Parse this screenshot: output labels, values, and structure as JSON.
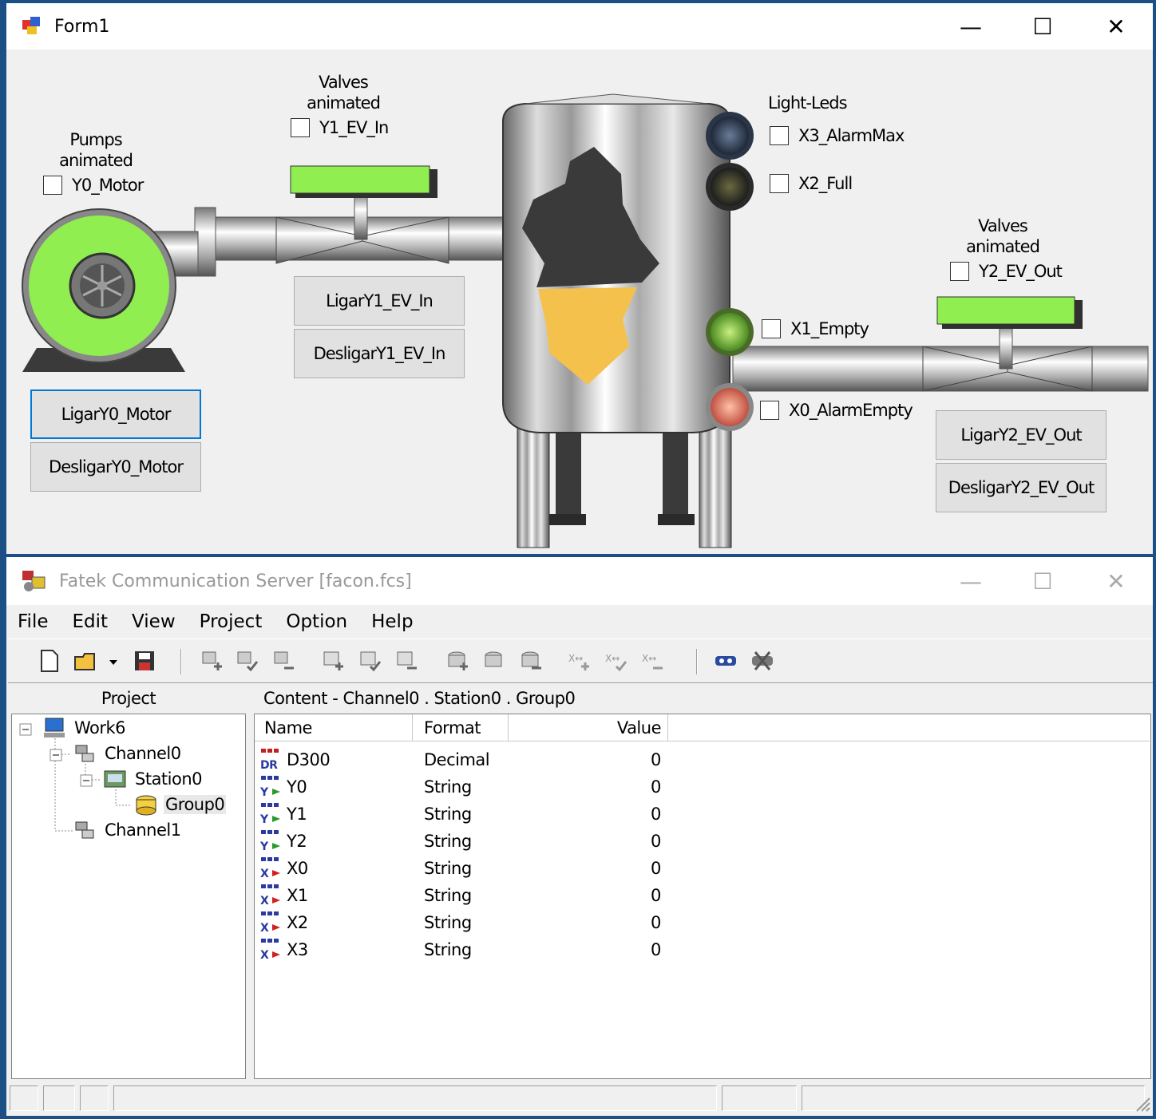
{
  "form1": {
    "title": "Form1",
    "pump": {
      "label": "Pumps\nanimated",
      "checkbox": "Y0_Motor",
      "on_button": "LigarY0_Motor",
      "off_button": "DesligarY0_Motor",
      "color": "#90ee50"
    },
    "valve_in": {
      "label": "Valves\nanimated",
      "checkbox": "Y1_EV_In",
      "on_button": "LigarY1_EV_In",
      "off_button": "DesligarY1_EV_In"
    },
    "leds": {
      "label": "Light-Leds",
      "x3": "X3_AlarmMax",
      "x2": "X2_Full",
      "x1": "X1_Empty",
      "x0": "X0_AlarmEmpty"
    },
    "valve_out": {
      "label": "Valves\nanimated",
      "checkbox": "Y2_EV_Out",
      "on_button": "LigarY2_EV_Out",
      "off_button": "DesligarY2_EV_Out"
    }
  },
  "fcs": {
    "title": "Fatek Communication Server [facon.fcs]",
    "menu": [
      "File",
      "Edit",
      "View",
      "Project",
      "Option",
      "Help"
    ],
    "project_header": "Project",
    "content_header": "Content - Channel0 . Station0 . Group0",
    "tree": {
      "work": "Work6",
      "channel0": "Channel0",
      "station0": "Station0",
      "group0": "Group0",
      "channel1": "Channel1"
    },
    "columns": {
      "name": "Name",
      "format": "Format",
      "value": "Value"
    },
    "rows": [
      {
        "name": "D300",
        "format": "Decimal",
        "value": "0",
        "icon": "register-icon"
      },
      {
        "name": "Y0",
        "format": "String",
        "value": "0",
        "icon": "output-icon"
      },
      {
        "name": "Y1",
        "format": "String",
        "value": "0",
        "icon": "output-icon"
      },
      {
        "name": "Y2",
        "format": "String",
        "value": "0",
        "icon": "output-icon"
      },
      {
        "name": "X0",
        "format": "String",
        "value": "0",
        "icon": "input-icon"
      },
      {
        "name": "X1",
        "format": "String",
        "value": "0",
        "icon": "input-icon"
      },
      {
        "name": "X2",
        "format": "String",
        "value": "0",
        "icon": "input-icon"
      },
      {
        "name": "X3",
        "format": "String",
        "value": "0",
        "icon": "input-icon"
      }
    ]
  }
}
